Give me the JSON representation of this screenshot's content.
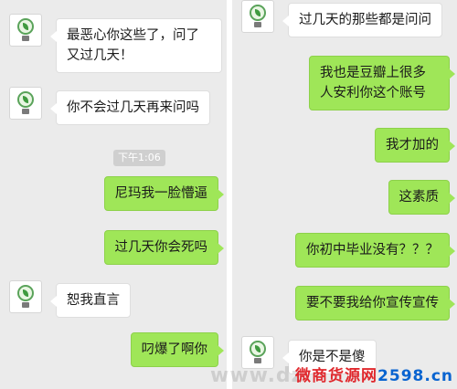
{
  "left": {
    "timestamp": "下午1:06",
    "messages": [
      {
        "side": "in",
        "text": "最恶心你这些了，问了又过几天！"
      },
      {
        "side": "in",
        "text": "你不会过几天再来问吗"
      },
      {
        "side": "out",
        "text": "尼玛我一脸懵逼"
      },
      {
        "side": "out",
        "text": "过几天你会死吗"
      },
      {
        "side": "in",
        "text": "恕我直言"
      },
      {
        "side": "out",
        "text": "叼爆了啊你"
      }
    ]
  },
  "right": {
    "messages": [
      {
        "side": "in",
        "text": "过几天的那些都是问问"
      },
      {
        "side": "out",
        "text": "我也是豆瓣上很多人安利你这个账号"
      },
      {
        "side": "out",
        "text": "我才加的"
      },
      {
        "side": "out",
        "text": "这素质"
      },
      {
        "side": "out",
        "text": "你初中毕业没有？？？"
      },
      {
        "side": "out",
        "text": "要不要我给你宣传宣传"
      },
      {
        "side": "in",
        "text": "你是不是傻"
      }
    ]
  },
  "watermark": {
    "left_text": "www.dz",
    "site_prefix": "微商货源网",
    "site_domain": "2598.cn"
  },
  "colors": {
    "chat_background": "#ebebeb",
    "outgoing_bubble": "#9fe658",
    "incoming_bubble": "#ffffff"
  },
  "icons": {
    "avatar": "lightbulb-leaf-icon"
  }
}
